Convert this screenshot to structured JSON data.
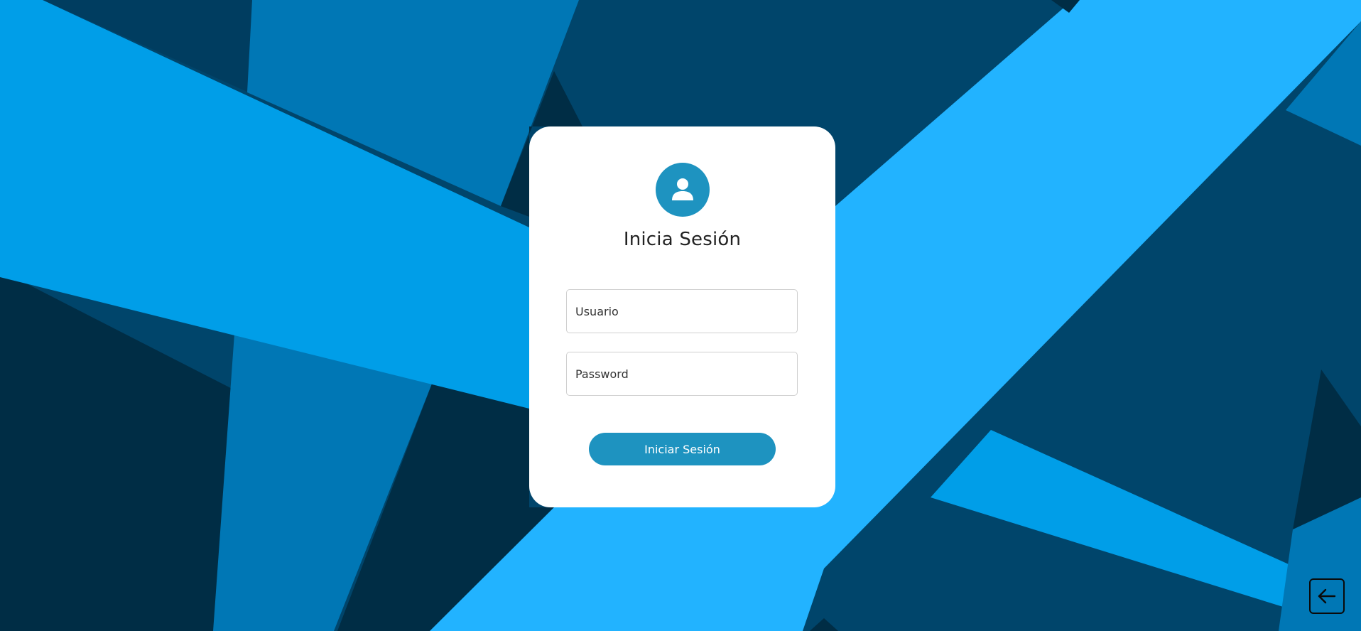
{
  "login": {
    "title": "Inicia Sesión",
    "username_placeholder": "Usuario",
    "password_placeholder": "Password",
    "submit_label": "Iniciar Sesión",
    "avatar_icon": "user-icon"
  },
  "navigation": {
    "back_icon": "arrow-left-icon"
  },
  "colors": {
    "accent": "#1e93c0",
    "card": "#ffffff",
    "bg_dark": "#002d45",
    "bg_mid": "#00456b",
    "bg_blue": "#0077b5",
    "bg_bright": "#009ee8",
    "bg_light": "#22b3ff"
  }
}
